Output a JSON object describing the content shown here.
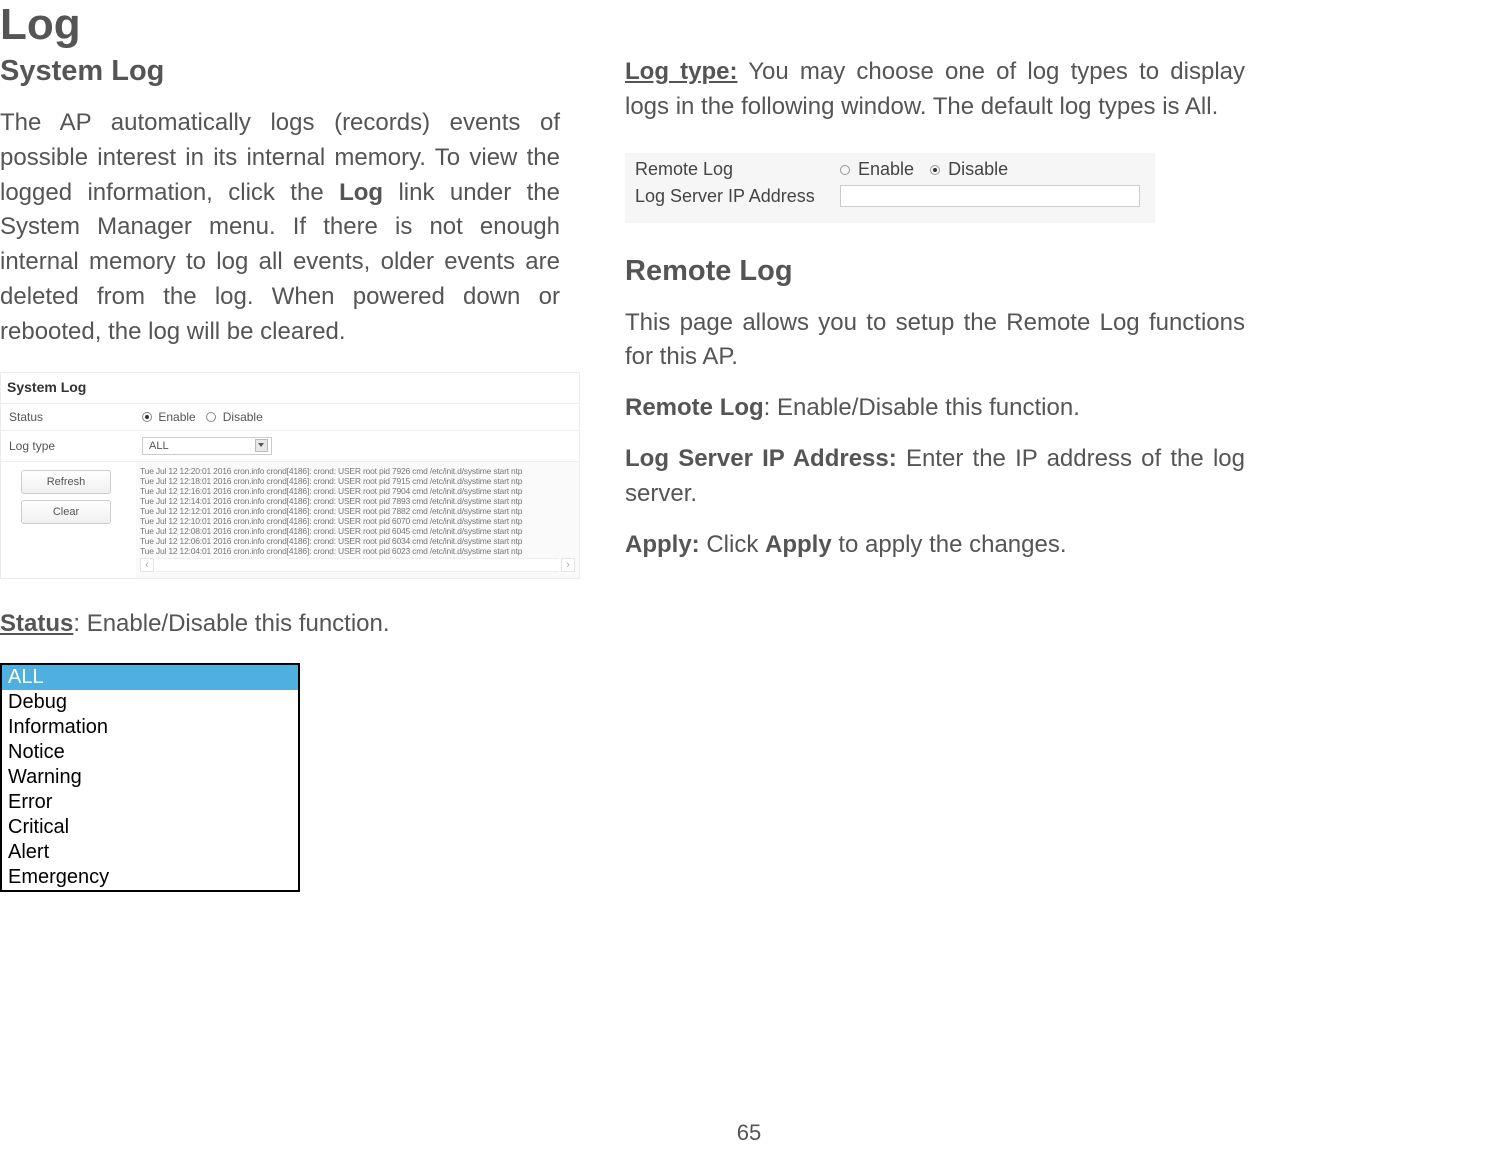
{
  "page": {
    "title": "Log",
    "number": "65"
  },
  "left": {
    "section_title": "System Log",
    "intro_part1": "The AP automatically logs (records) events of possible interest in its internal memory. To view the logged information, click the ",
    "intro_bold": "Log",
    "intro_part2": " link under the System Manager menu. If there is not enough internal memory to log all events, older events are deleted from the log. When powered down or rebooted, the log will be cleared.",
    "status_label": "Status",
    "status_desc": ": Enable/Disable this function.",
    "shot": {
      "header": "System Log",
      "status_label": "Status",
      "enable": "Enable",
      "disable": "Disable",
      "logtype_label": "Log type",
      "logtype_value": "ALL",
      "btn_refresh": "Refresh",
      "btn_clear": "Clear",
      "log_lines": [
        "Tue Jul 12 12:20:01 2016 cron.info crond[4186]: crond: USER root pid 7926 cmd /etc/init.d/systime start ntp",
        "Tue Jul 12 12:18:01 2016 cron.info crond[4186]: crond: USER root pid 7915 cmd /etc/init.d/systime start ntp",
        "Tue Jul 12 12:16:01 2016 cron.info crond[4186]: crond: USER root pid 7904 cmd /etc/init.d/systime start ntp",
        "Tue Jul 12 12:14:01 2016 cron.info crond[4186]: crond: USER root pid 7893 cmd /etc/init.d/systime start ntp",
        "Tue Jul 12 12:12:01 2016 cron.info crond[4186]: crond: USER root pid 7882 cmd /etc/init.d/systime start ntp",
        "Tue Jul 12 12:10:01 2016 cron.info crond[4186]: crond: USER root pid 6070 cmd /etc/init.d/systime start ntp",
        "Tue Jul 12 12:08:01 2016 cron.info crond[4186]: crond: USER root pid 6045 cmd /etc/init.d/systime start ntp",
        "Tue Jul 12 12:06:01 2016 cron.info crond[4186]: crond: USER root pid 6034 cmd /etc/init.d/systime start ntp",
        "Tue Jul 12 12:04:01 2016 cron.info crond[4186]: crond: USER root pid 6023 cmd /etc/init.d/systime start ntp"
      ]
    },
    "logtype_options": [
      "ALL",
      "Debug",
      "Information",
      "Notice",
      "Warning",
      "Error",
      "Critical",
      "Alert",
      "Emergency"
    ]
  },
  "right": {
    "logtype_label": "Log type:",
    "logtype_desc": " You may choose one of log types to display logs in the following window. The default log types is All.",
    "remotelog_shot": {
      "label1": "Remote Log",
      "enable": "Enable",
      "disable": "Disable",
      "label2": "Log Server IP Address"
    },
    "section_title": "Remote Log",
    "intro": "This page allows you to setup the Remote Log functions for this AP.",
    "remotelog_label": "Remote Log",
    "remotelog_desc": ": Enable/Disable this function.",
    "logserver_label": "Log Server IP Address:",
    "logserver_desc": " Enter the IP address of the log server.",
    "apply_label": "Apply:",
    "apply_desc1": " Click ",
    "apply_bold": "Apply",
    "apply_desc2": " to apply the changes."
  }
}
